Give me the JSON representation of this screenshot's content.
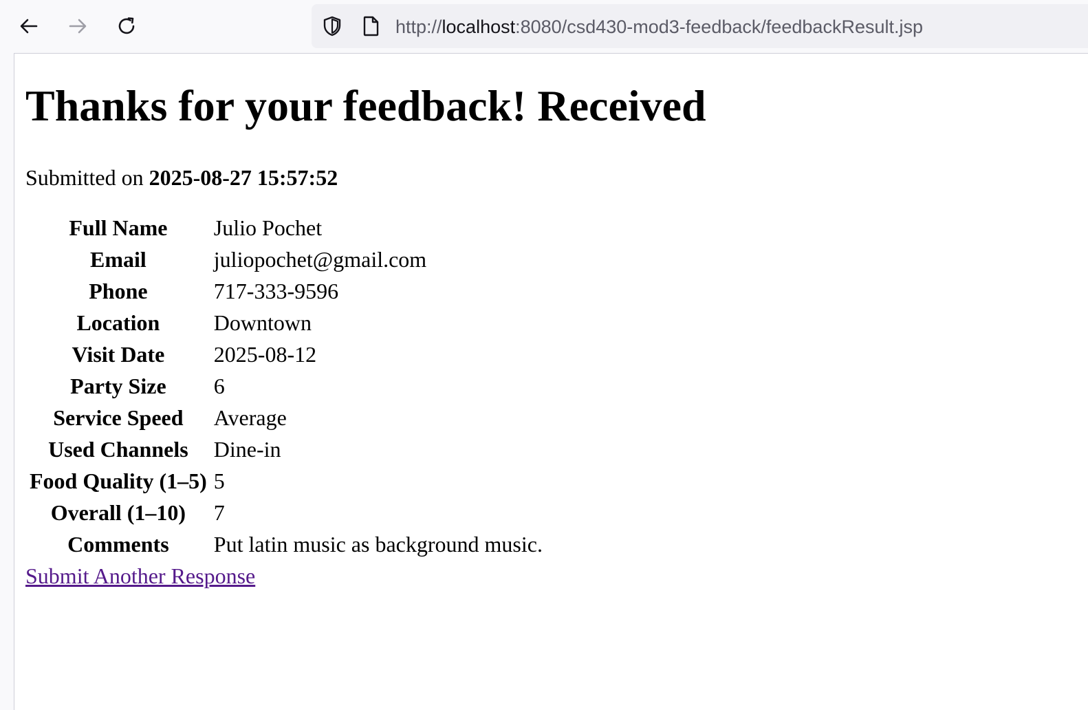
{
  "browser": {
    "url_scheme": "http://",
    "url_host": "localhost",
    "url_path": ":8080/csd430-mod3-feedback/feedbackResult.jsp"
  },
  "page": {
    "title": "Thanks for your feedback! Received",
    "submitted_prefix": "Submitted on ",
    "submitted_timestamp": "2025-08-27 15:57:52",
    "fields": [
      {
        "label": "Full Name",
        "value": "Julio Pochet"
      },
      {
        "label": "Email",
        "value": "juliopochet@gmail.com"
      },
      {
        "label": "Phone",
        "value": "717-333-9596"
      },
      {
        "label": "Location",
        "value": "Downtown"
      },
      {
        "label": "Visit Date",
        "value": "2025-08-12"
      },
      {
        "label": "Party Size",
        "value": "6"
      },
      {
        "label": "Service Speed",
        "value": "Average"
      },
      {
        "label": "Used Channels",
        "value": "Dine-in"
      },
      {
        "label": "Food Quality (1–5)",
        "value": "5"
      },
      {
        "label": "Overall (1–10)",
        "value": "7"
      },
      {
        "label": "Comments",
        "value": "Put latin music as background music."
      }
    ],
    "link_label": "Submit Another Response"
  },
  "colors": {
    "visited_link": "#551a8b",
    "url_bar_bg": "#f0f0f4"
  }
}
